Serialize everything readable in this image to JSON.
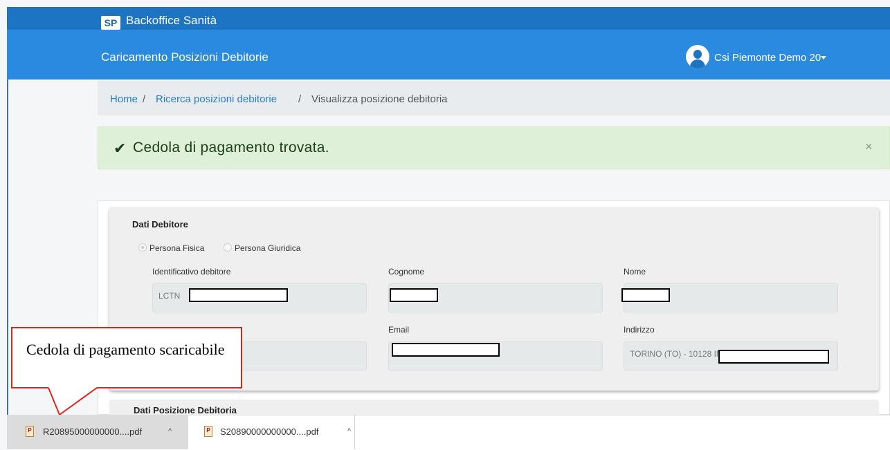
{
  "header": {
    "logo_text": "SP",
    "app_title": "Backoffice Sanità",
    "page_title": "Caricamento Posizioni Debitorie",
    "user_name": "Csi Piemonte Demo 20"
  },
  "breadcrumb": {
    "home": "Home",
    "sep1": "/",
    "search": "Ricerca posizioni debitorie",
    "sep2": "/",
    "current": "Visualizza posizione debitoria"
  },
  "alert": {
    "check_icon": "✔",
    "message": "Cedola di pagamento trovata.",
    "close": "×"
  },
  "debtor": {
    "title": "Dati Debitore",
    "radio_physical": "Persona Fisica",
    "radio_legal": "Persona Giuridica",
    "selected": "Persona Fisica",
    "id_label": "Identificativo debitore",
    "id_value": "LCTN",
    "surname_label": "Cognome",
    "name_label": "Nome",
    "email_label": "Email",
    "address_label": "Indirizzo",
    "address_value": "TORINO (TO) - 10128 IN VIA"
  },
  "position": {
    "title": "Dati Posizione Debitoria"
  },
  "callout": {
    "text": "Cedola di pagamento scaricabile"
  },
  "downloads": [
    {
      "filename": "R20895000000000....pdf",
      "caret": "^"
    },
    {
      "filename": "S20890000000000....pdf",
      "caret": "^"
    }
  ],
  "colors": {
    "top_bar": "#1d74c3",
    "sub_bar": "#2a8ae0",
    "alert_bg": "#dff0d8",
    "callout_border": "#e3231b"
  }
}
